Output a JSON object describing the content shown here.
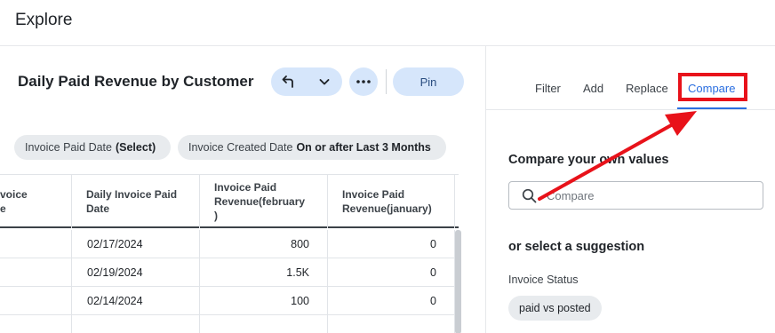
{
  "app": {
    "title": "Explore"
  },
  "visualization": {
    "title": "Daily Paid Revenue by Customer",
    "pin_label": "Pin"
  },
  "filters": [
    {
      "label": "Invoice Paid Date",
      "value": "(Select)"
    },
    {
      "label": "Invoice Created Date",
      "value": "On or after Last 3 Months"
    }
  ],
  "table": {
    "columns": [
      [
        "voice",
        "e"
      ],
      [
        "Daily Invoice Paid",
        "Date"
      ],
      [
        "Invoice Paid",
        "Revenue(february",
        ")"
      ],
      [
        "Invoice Paid",
        "Revenue(january)"
      ]
    ],
    "rows": [
      {
        "date": "02/17/2024",
        "feb": "800",
        "jan": "0"
      },
      {
        "date": "02/19/2024",
        "feb": "1.5K",
        "jan": "0"
      },
      {
        "date": "02/14/2024",
        "feb": "100",
        "jan": "0"
      }
    ]
  },
  "panel": {
    "tabs": [
      "Filter",
      "Add",
      "Replace",
      "Compare"
    ],
    "active_tab": "Compare",
    "compare_title": "Compare your own values",
    "compare_placeholder": "Compare",
    "suggestion_title": "or select a suggestion",
    "suggestion_group": "Invoice Status",
    "suggestion_chip": "paid vs posted"
  },
  "colors": {
    "accent": "#2a6ee0",
    "button_bg": "#d6e6fb",
    "annotation_red": "#e8121a"
  },
  "icons": [
    "undo-arrow-icon",
    "chevron-down-icon",
    "more-horizontal-icon",
    "search-icon"
  ]
}
